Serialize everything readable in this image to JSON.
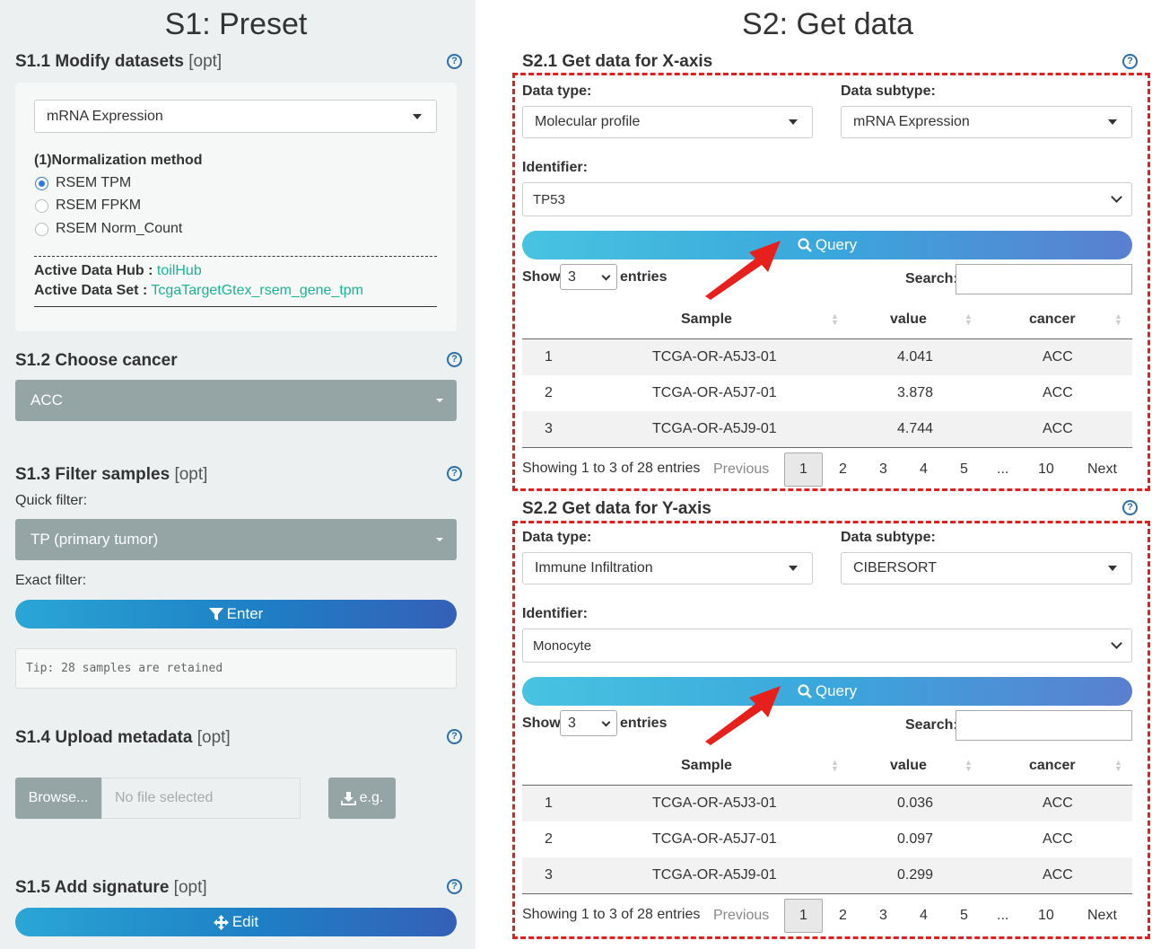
{
  "s1": {
    "title": "S1: Preset",
    "s11": {
      "title": "S1.1 Modify datasets",
      "opt": "[opt]",
      "dataset_select": "mRNA Expression",
      "norm_label": "(1)Normalization method",
      "norm_options": [
        "RSEM TPM",
        "RSEM FPKM",
        "RSEM Norm_Count"
      ],
      "hub_label": "Active Data Hub :",
      "hub_value": "toilHub",
      "set_label": "Active Data Set :",
      "set_value": "TcgaTargetGtex_rsem_gene_tpm"
    },
    "s12": {
      "title": "S1.2 Choose cancer",
      "cancer": "ACC"
    },
    "s13": {
      "title": "S1.3 Filter samples",
      "opt": "[opt]",
      "quick_label": "Quick filter:",
      "quick_value": "TP (primary tumor)",
      "exact_label": "Exact filter:",
      "enter_label": "Enter",
      "tip": "Tip: 28 samples are retained"
    },
    "s14": {
      "title": "S1.4 Upload metadata",
      "opt": "[opt]",
      "browse": "Browse...",
      "file_placeholder": "No file selected",
      "eg": "e.g."
    },
    "s15": {
      "title": "S1.5 Add signature",
      "opt": "[opt]",
      "edit": "Edit"
    }
  },
  "s2": {
    "title": "S2: Get data",
    "x": {
      "title": "S2.1 Get data for X-axis",
      "data_type_label": "Data type:",
      "data_type": "Molecular profile",
      "subtype_label": "Data subtype:",
      "subtype": "mRNA Expression",
      "identifier_label": "Identifier:",
      "identifier": "TP53",
      "query": "Query",
      "show": "Show",
      "show_value": "3",
      "entries": "entries",
      "search": "Search:",
      "headers": [
        "Sample",
        "value",
        "cancer"
      ],
      "rows": [
        {
          "n": "1",
          "sample": "TCGA-OR-A5J3-01",
          "value": "4.041",
          "cancer": "ACC"
        },
        {
          "n": "2",
          "sample": "TCGA-OR-A5J7-01",
          "value": "3.878",
          "cancer": "ACC"
        },
        {
          "n": "3",
          "sample": "TCGA-OR-A5J9-01",
          "value": "4.744",
          "cancer": "ACC"
        }
      ],
      "info": "Showing 1 to 3 of 28 entries",
      "previous": "Previous",
      "pages": [
        "1",
        "2",
        "3",
        "4",
        "5",
        "...",
        "10"
      ],
      "next": "Next"
    },
    "y": {
      "title": "S2.2 Get data for Y-axis",
      "data_type_label": "Data type:",
      "data_type": "Immune Infiltration",
      "subtype_label": "Data subtype:",
      "subtype": "CIBERSORT",
      "identifier_label": "Identifier:",
      "identifier": "Monocyte",
      "query": "Query",
      "show": "Show",
      "show_value": "3",
      "entries": "entries",
      "search": "Search:",
      "headers": [
        "Sample",
        "value",
        "cancer"
      ],
      "rows": [
        {
          "n": "1",
          "sample": "TCGA-OR-A5J3-01",
          "value": "0.036",
          "cancer": "ACC"
        },
        {
          "n": "2",
          "sample": "TCGA-OR-A5J7-01",
          "value": "0.097",
          "cancer": "ACC"
        },
        {
          "n": "3",
          "sample": "TCGA-OR-A5J9-01",
          "value": "0.299",
          "cancer": "ACC"
        }
      ],
      "info": "Showing 1 to 3 of 28 entries",
      "previous": "Previous",
      "pages": [
        "1",
        "2",
        "3",
        "4",
        "5",
        "...",
        "10"
      ],
      "next": "Next"
    }
  },
  "colors": {
    "accent": "#1e7fc5",
    "gray": "#95a5a6",
    "annotation": "#e02020",
    "link": "#1ab394"
  },
  "help_icon": "?"
}
